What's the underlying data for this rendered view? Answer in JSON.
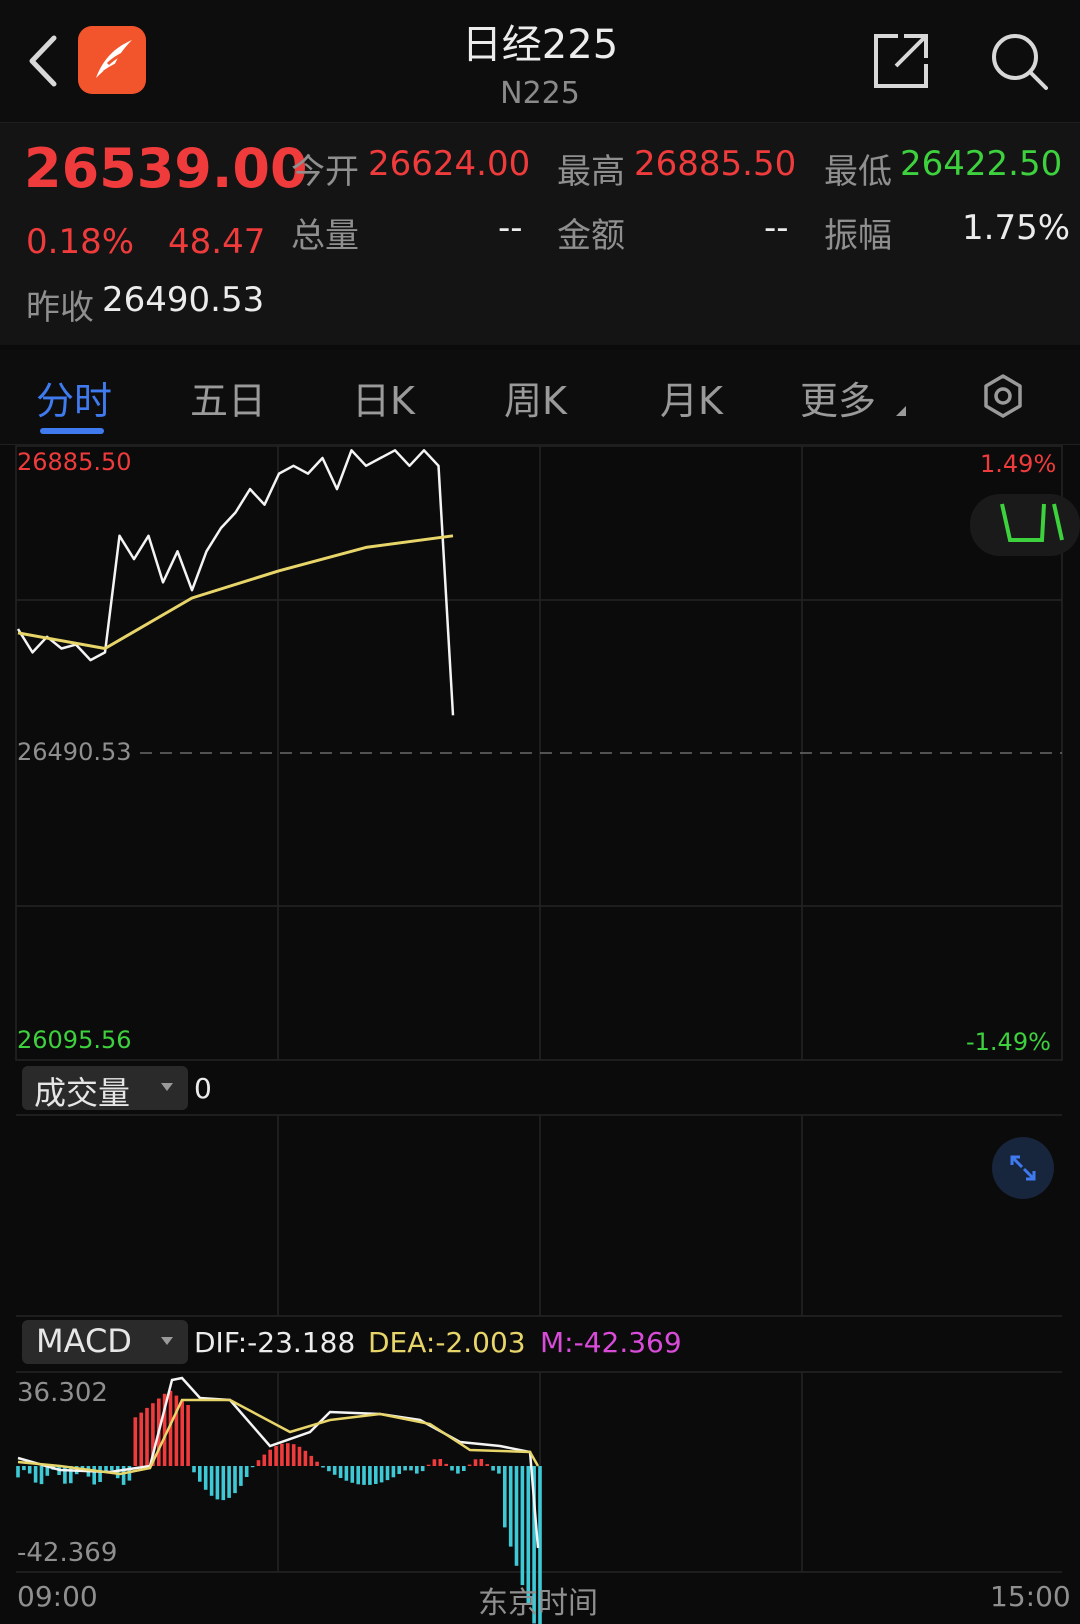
{
  "header": {
    "title": "日经225",
    "subtitle": "N225"
  },
  "quote": {
    "price": "26539.00",
    "change_pct": "0.18%",
    "change_abs": "48.47",
    "prev_close_label": "昨收",
    "prev_close": "26490.53",
    "open_label": "今开",
    "open": "26624.00",
    "high_label": "最高",
    "high": "26885.50",
    "low_label": "最低",
    "low": "26422.50",
    "volume_label": "总量",
    "volume": "--",
    "amount_label": "金额",
    "amount": "--",
    "amplitude_label": "振幅",
    "amplitude": "1.75%"
  },
  "tabs": [
    {
      "label": "分时"
    },
    {
      "label": "五日"
    },
    {
      "label": "日K"
    },
    {
      "label": "周K"
    },
    {
      "label": "月K"
    },
    {
      "label": "更多"
    }
  ],
  "price_chart": {
    "top_price": "26885.50",
    "top_pct": "1.49%",
    "mid_price": "26490.53",
    "bottom_price": "26095.56",
    "bottom_pct": "-1.49%"
  },
  "volume_panel": {
    "selector_label": "成交量",
    "value": "0"
  },
  "macd_panel": {
    "selector_label": "MACD",
    "dif": "DIF:-23.188",
    "dea": "DEA:-2.003",
    "m": "M:-42.369",
    "top_value": "36.302",
    "bottom_value": "-42.369"
  },
  "time_axis": {
    "start": "09:00",
    "center": "东京时间",
    "end": "15:00"
  },
  "colors": {
    "up": "#ef3b3b",
    "down": "#3ed13e",
    "accent": "#3f7bef",
    "avg_line": "#e8d56a",
    "macd_hist_neg": "#3ec9d6",
    "macd_m": "#d94bd9"
  },
  "chart_data": {
    "type": "line",
    "x_range": [
      "09:00",
      "15:00"
    ],
    "ylim": [
      26095.56,
      26885.5
    ],
    "reference": 26490.53,
    "series": [
      {
        "name": "",
        "x": [
          "09:00",
          "09:05",
          "09:10",
          "09:15",
          "09:20",
          "09:25",
          "09:30",
          "09:35",
          "09:40",
          "09:45",
          "09:50",
          "09:55",
          "10:00",
          "10:05",
          "10:10",
          "10:15",
          "10:20",
          "10:25",
          "10:30",
          "10:35",
          "10:40",
          "10:45",
          "10:50",
          "10:55",
          "11:00",
          "11:05",
          "11:10",
          "11:15",
          "11:20",
          "11:25",
          "11:30"
        ],
        "values": [
          26650,
          26620,
          26640,
          26625,
          26630,
          26610,
          26620,
          26770,
          26740,
          26770,
          26710,
          26750,
          26700,
          26750,
          26780,
          26800,
          26830,
          26810,
          26850,
          26860,
          26850,
          26870,
          26830,
          26880,
          26860,
          26870,
          26880,
          26860,
          26880,
          26860,
          26539
        ]
      },
      {
        "name": "",
        "x": [
          "09:00",
          "09:30",
          "10:00",
          "10:30",
          "11:00",
          "11:30"
        ],
        "values": [
          26645,
          26625,
          26690,
          26725,
          26755,
          26770
        ]
      }
    ]
  }
}
